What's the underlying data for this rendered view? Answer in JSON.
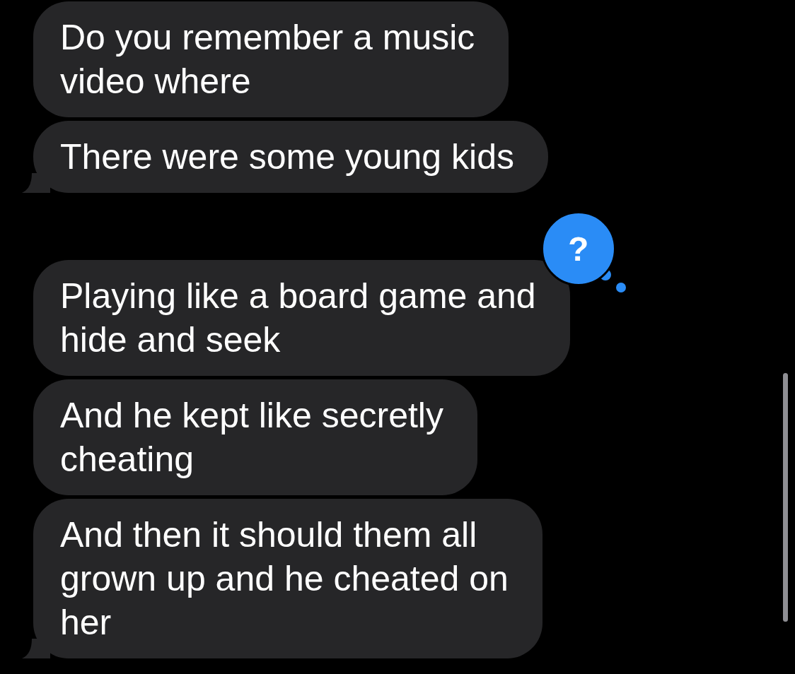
{
  "messages": [
    {
      "text": "Do you remember a music\nvideo where",
      "tail": false
    },
    {
      "text": "There were some young kids",
      "tail": true
    },
    {
      "text": "Playing like a board game and\nhide and seek",
      "tail": false,
      "tapback": {
        "symbol": "?"
      }
    },
    {
      "text": "And he kept like secretly\ncheating",
      "tail": false
    },
    {
      "text": "And then it should them all\ngrown up and he cheated on\nher",
      "tail": true
    }
  ]
}
